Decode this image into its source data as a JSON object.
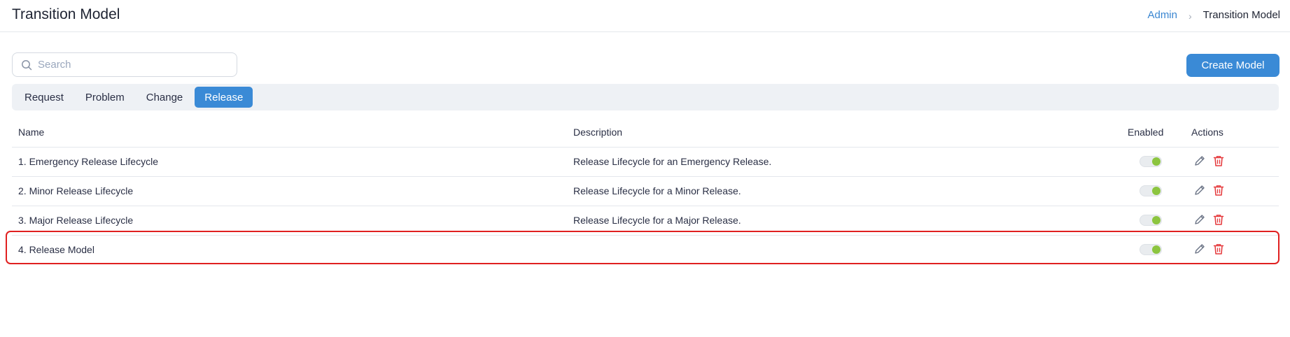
{
  "header": {
    "title": "Transition Model",
    "breadcrumb": [
      {
        "label": "Admin",
        "link": true
      },
      {
        "label": "Transition Model",
        "link": false
      }
    ],
    "separator": "›"
  },
  "search": {
    "placeholder": "Search",
    "value": "",
    "icon": "search-icon"
  },
  "toolbar": {
    "create_label": "Create Model"
  },
  "tabs": [
    {
      "label": "Request",
      "active": false
    },
    {
      "label": "Problem",
      "active": false
    },
    {
      "label": "Change",
      "active": false
    },
    {
      "label": "Release",
      "active": true
    }
  ],
  "table": {
    "columns": {
      "name": "Name",
      "description": "Description",
      "enabled": "Enabled",
      "actions": "Actions"
    },
    "rows": [
      {
        "name": "1. Emergency Release Lifecycle",
        "description": "Release Lifecycle for an Emergency Release.",
        "enabled": true,
        "highlighted": false
      },
      {
        "name": "2. Minor Release Lifecycle",
        "description": "Release Lifecycle for a Minor Release.",
        "enabled": true,
        "highlighted": false
      },
      {
        "name": "3. Major Release Lifecycle",
        "description": "Release Lifecycle for a Major Release.",
        "enabled": true,
        "highlighted": false
      },
      {
        "name": "4. Release Model",
        "description": "",
        "enabled": true,
        "highlighted": true
      }
    ]
  },
  "icons": {
    "edit": "pencil-icon",
    "delete": "trash-icon"
  },
  "colors": {
    "accent": "#3a8ad6",
    "link": "#3a86d1",
    "toggle_on": "#8cc53f",
    "delete": "#e5383b",
    "highlight": "#e02020"
  }
}
